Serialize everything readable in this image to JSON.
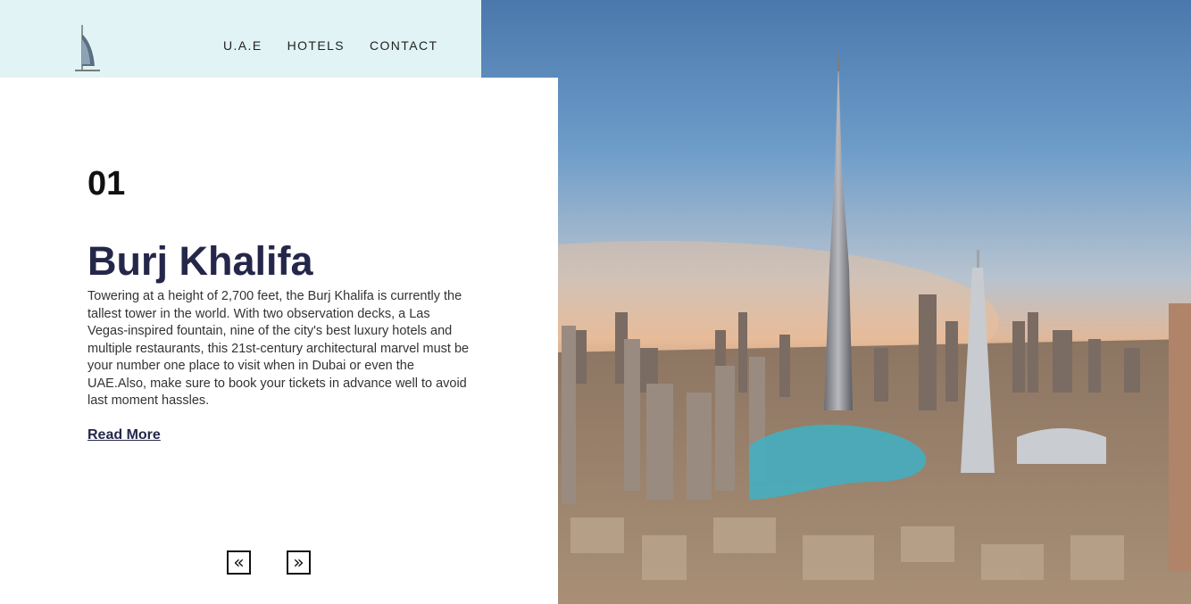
{
  "nav": {
    "logo_icon": "burj-al-arab-icon",
    "links": [
      "U.A.E",
      "HOTELS",
      "CONTACT"
    ]
  },
  "slide": {
    "number": "01",
    "title": "Burj Khalifa",
    "description": "Towering at a height of 2,700 feet, the Burj Khalifa is currently the tallest tower in the world. With two observation decks, a Las Vegas-inspired fountain, nine of the city's best luxury hotels and multiple restaurants, this 21st-century architectural marvel must be your number one place to visit when in Dubai or even the UAE.Also, make sure to book your tickets in advance well to avoid last moment hassles.",
    "read_more": "Read More"
  },
  "controls": {
    "prev_label": "«",
    "next_label": "»",
    "prev_icon": "double-chevron-left-icon",
    "next_icon": "double-chevron-right-icon"
  },
  "colors": {
    "nav_bg": "#e1f3f4",
    "title": "#25274a",
    "sky_top": "#4a78ad"
  }
}
